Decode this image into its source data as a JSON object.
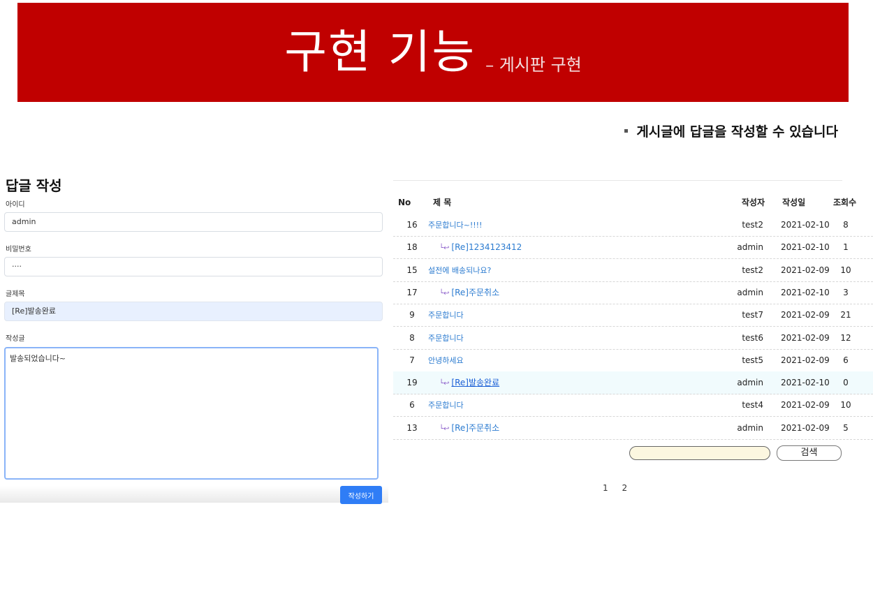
{
  "banner": {
    "title": "구현 기능",
    "subtitle": "– 게시판 구현"
  },
  "subtitle": "게시글에 답글을 작성할 수 있습니다",
  "form": {
    "title": "답글 작성",
    "id_label": "아이디",
    "id_value": "admin",
    "password_label": "비밀번호",
    "password_value": "····",
    "post_title_label": "글제목",
    "post_title_value": "[Re]발송완료",
    "content_label": "작성글",
    "content_value": "발송되었습니다~",
    "submit_label": "작성하기"
  },
  "board": {
    "headers": {
      "no": "No",
      "title": "제 목",
      "author": "작성자",
      "date": "작성일",
      "views": "조회수"
    },
    "rows": [
      {
        "no": "16",
        "title": "주문합니다~!!!!",
        "reply": false,
        "author": "test2",
        "date": "2021-02-10",
        "views": "8"
      },
      {
        "no": "18",
        "title": "[Re]1234123412",
        "reply": true,
        "author": "admin",
        "date": "2021-02-10",
        "views": "1"
      },
      {
        "no": "15",
        "title": "설전에 배송되나요?",
        "reply": false,
        "author": "test2",
        "date": "2021-02-09",
        "views": "10"
      },
      {
        "no": "17",
        "title": "[Re]주문취소",
        "reply": true,
        "author": "admin",
        "date": "2021-02-10",
        "views": "3"
      },
      {
        "no": "9",
        "title": "주문합니다",
        "reply": false,
        "author": "test7",
        "date": "2021-02-09",
        "views": "21"
      },
      {
        "no": "8",
        "title": "주문합니다",
        "reply": false,
        "author": "test6",
        "date": "2021-02-09",
        "views": "12"
      },
      {
        "no": "7",
        "title": "안녕하세요",
        "reply": false,
        "author": "test5",
        "date": "2021-02-09",
        "views": "6"
      },
      {
        "no": "19",
        "title": "[Re]발송완료",
        "reply": true,
        "author": "admin",
        "date": "2021-02-10",
        "views": "0"
      },
      {
        "no": "6",
        "title": "주문합니다",
        "reply": false,
        "author": "test4",
        "date": "2021-02-09",
        "views": "10"
      },
      {
        "no": "13",
        "title": "[Re]주문취소",
        "reply": true,
        "author": "admin",
        "date": "2021-02-09",
        "views": "5"
      }
    ],
    "reply_icon": "reply-arrow-icon",
    "search_button": "검색",
    "pages": [
      "1",
      "2"
    ]
  }
}
